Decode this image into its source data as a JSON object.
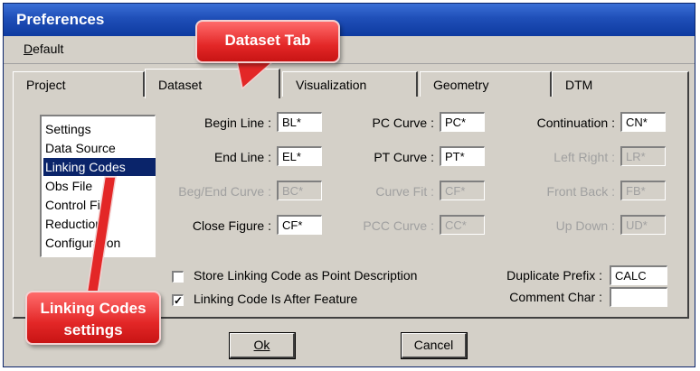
{
  "window": {
    "title": "Preferences"
  },
  "menu": {
    "default_label": "Default"
  },
  "tabs": [
    {
      "label": "Project"
    },
    {
      "label": "Dataset"
    },
    {
      "label": "Visualization"
    },
    {
      "label": "Geometry"
    },
    {
      "label": "DTM"
    }
  ],
  "sidebar": {
    "items": [
      {
        "label": "Settings"
      },
      {
        "label": "Data Source"
      },
      {
        "label": "Linking Codes"
      },
      {
        "label": "Obs File"
      },
      {
        "label": "Control File"
      },
      {
        "label": "Reduction"
      },
      {
        "label": "Configuration"
      }
    ],
    "selected": "Linking Codes"
  },
  "fields": {
    "begin_line": {
      "label": "Begin Line :",
      "value": "BL*"
    },
    "end_line": {
      "label": "End Line :",
      "value": "EL*"
    },
    "beg_end_curve": {
      "label": "Beg/End Curve :",
      "value": "BC*"
    },
    "close_figure": {
      "label": "Close Figure :",
      "value": "CF*"
    },
    "pc_curve": {
      "label": "PC Curve :",
      "value": "PC*"
    },
    "pt_curve": {
      "label": "PT Curve :",
      "value": "PT*"
    },
    "curve_fit": {
      "label": "Curve Fit :",
      "value": "CF*"
    },
    "pcc_curve": {
      "label": "PCC Curve :",
      "value": "CC*"
    },
    "continuation": {
      "label": "Continuation :",
      "value": "CN*"
    },
    "left_right": {
      "label": "Left Right :",
      "value": "LR*"
    },
    "front_back": {
      "label": "Front Back :",
      "value": "FB*"
    },
    "up_down": {
      "label": "Up Down :",
      "value": "UD*"
    },
    "duplicate_prefix": {
      "label": "Duplicate Prefix :",
      "value": "CALC"
    },
    "comment_char": {
      "label": "Comment Char :",
      "value": ""
    }
  },
  "checkboxes": {
    "store_desc": {
      "label": "Store Linking Code as Point Description",
      "checked": false
    },
    "after_feature": {
      "label": "Linking Code Is After Feature",
      "checked": true,
      "mark": "✓"
    }
  },
  "buttons": {
    "ok": "Ok",
    "cancel": "Cancel"
  },
  "callouts": {
    "dataset_tab": "Dataset Tab",
    "linking_codes_line1": "Linking Codes",
    "linking_codes_line2": "settings"
  },
  "colors": {
    "callout_red": "#e32727",
    "titlebar_blue": "#1f4fb8",
    "selection": "#0a246a"
  }
}
